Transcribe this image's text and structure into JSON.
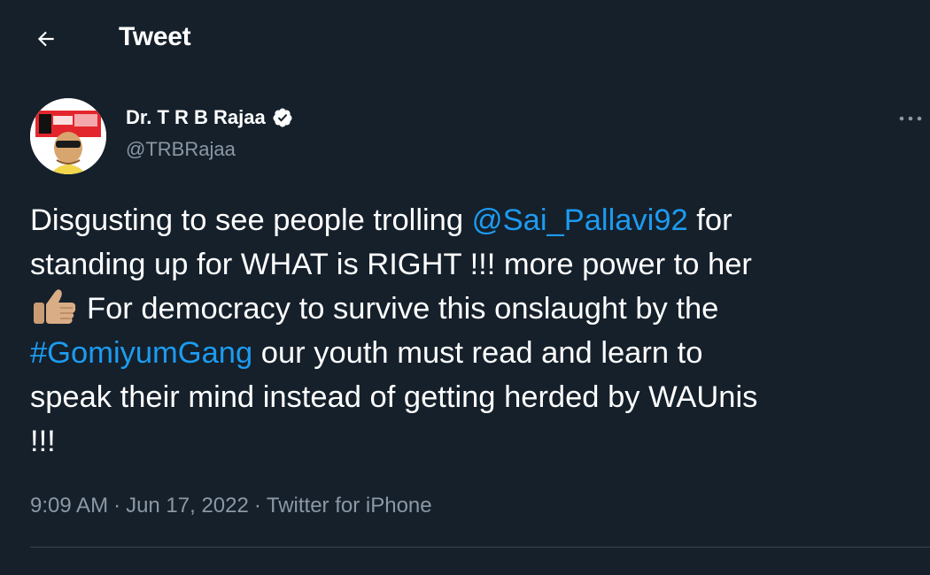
{
  "header": {
    "title": "Tweet",
    "back_icon": "arrow-left-icon"
  },
  "author": {
    "name": "Dr. T R B Rajaa",
    "handle": "@TRBRajaa",
    "verified_icon": "verified-badge-icon",
    "avatar_icon": "profile-avatar"
  },
  "more_icon": "more-horizontal-icon",
  "tweet": {
    "line1_text": "Disgusting to see people trolling ",
    "mention": "@Sai_Pallavi92",
    "line1_end": " for",
    "line2": "standing up for WHAT is RIGHT !!! more power to her",
    "emoji_icon": "thumbs-up-emoji",
    "line3": "For democracy to survive this onslaught by the",
    "hashtag": "#GomiyumGang",
    "line4_end": " our youth must read and learn to",
    "line5": "speak their mind instead of getting herded by WAUnis",
    "line6": "!!!"
  },
  "meta": {
    "time": "9:09 AM",
    "sep1": "·",
    "date": "Jun 17, 2022",
    "sep2": "·",
    "source": "Twitter for iPhone"
  },
  "colors": {
    "background": "#15202b",
    "link": "#1d9bf0",
    "secondary_text": "#8b98a5",
    "divider": "#38444d"
  }
}
